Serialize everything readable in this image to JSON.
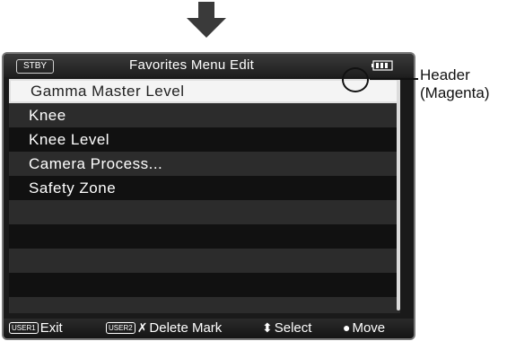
{
  "status_badge": "STBY",
  "header": {
    "title": "Favorites Menu Edit"
  },
  "menu": {
    "items": [
      "Gamma Master Level",
      "Knee",
      "Knee Level",
      "Camera Process...",
      "Safety Zone",
      "",
      "",
      "",
      "",
      ""
    ],
    "selected_index": 0
  },
  "footer": {
    "user1_badge": "USER1",
    "exit_label": "Exit",
    "user2_badge": "USER2",
    "delete_glyph": "✗",
    "delete_label": "Delete Mark",
    "select_glyph": "⬍",
    "select_label": "Select",
    "move_glyph": "●",
    "move_label": "Move"
  },
  "callout": {
    "line1": "Header",
    "line2": "(Magenta)"
  },
  "icons": {
    "arrow": "down-arrow-icon",
    "battery": "battery-icon"
  },
  "colors": {
    "screen_bg": "#1a1a1a",
    "selected_bg": "#f4f4f4",
    "row_alt": "#2c2c2c",
    "row_plain": "#111111"
  }
}
